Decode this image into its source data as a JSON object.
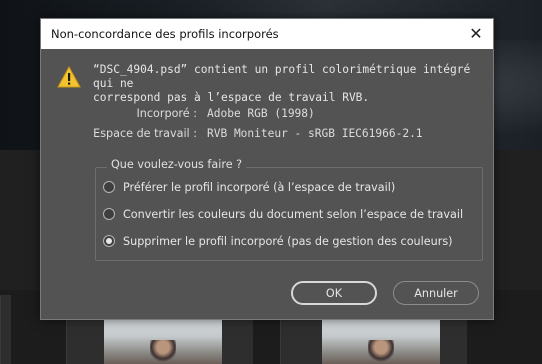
{
  "dialog": {
    "title": "Non-concordance des profils incorporés",
    "close_symbol": "✕",
    "message_line1": "“DSC_4904.psd” contient un profil colorimétrique intégré qui ne",
    "message_line2": "correspond pas à l’espace de travail RVB.",
    "embedded_label": "Incorporé :",
    "embedded_value": "Adobe RGB (1998)",
    "workspace_label": "Espace de travail :",
    "workspace_value": "RVB Moniteur - sRGB IEC61966-2.1",
    "group_title": "Que voulez-vous faire ?",
    "options": [
      {
        "label": "Préférer le profil incorporé (à l’espace de travail)",
        "checked": false
      },
      {
        "label": "Convertir les couleurs du document selon l’espace de travail",
        "checked": false
      },
      {
        "label": "Supprimer le profil incorporé (pas de gestion des couleurs)",
        "checked": true
      }
    ],
    "ok_label": "OK",
    "cancel_label": "Annuler"
  },
  "icons": {
    "warning": "warning-icon",
    "close": "close-icon"
  },
  "colors": {
    "dialog_bg": "#535353",
    "warning_fill": "#f2c230"
  }
}
